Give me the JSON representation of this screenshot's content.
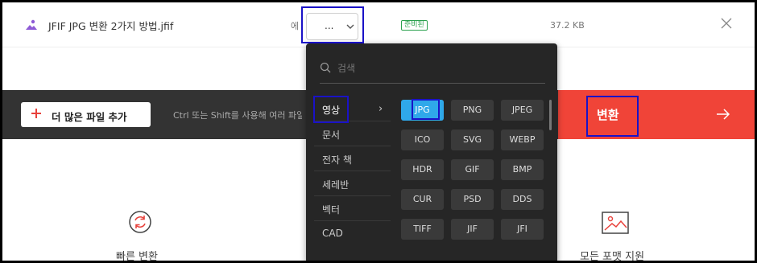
{
  "file": {
    "name": "JFIF JPG 변환 2가지 방법.jfif",
    "to_label": "에",
    "selected_format": "...",
    "status": "준비된",
    "size": "37.2 KB"
  },
  "toolbar": {
    "add_files_label": "더 많은 파일 추가",
    "hint": "Ctrl 또는 Shift를 사용해 여러 파일",
    "convert_label": "변환"
  },
  "features": [
    {
      "label": "빠른 변환",
      "icon": "refresh-icon"
    },
    {
      "label": "모든 포맷 지원",
      "icon": "image-icon"
    }
  ],
  "dropdown": {
    "search_placeholder": "검색",
    "categories": [
      {
        "label": "영상",
        "active": true
      },
      {
        "label": "문서"
      },
      {
        "label": "전자 책"
      },
      {
        "label": "세레반"
      },
      {
        "label": "벡터"
      },
      {
        "label": "CAD"
      }
    ],
    "formats": [
      "JPG",
      "PNG",
      "JPEG",
      "ICO",
      "SVG",
      "WEBP",
      "HDR",
      "GIF",
      "BMP",
      "CUR",
      "PSD",
      "DDS",
      "TIFF",
      "JIF",
      "JFI"
    ],
    "selected": "JPG"
  },
  "colors": {
    "convert": "#f04438",
    "toolbar": "#333333",
    "panel": "#262626",
    "selected_format": "#2fa8ea",
    "highlight": "#1a12c7",
    "status": "#2aa14e"
  }
}
